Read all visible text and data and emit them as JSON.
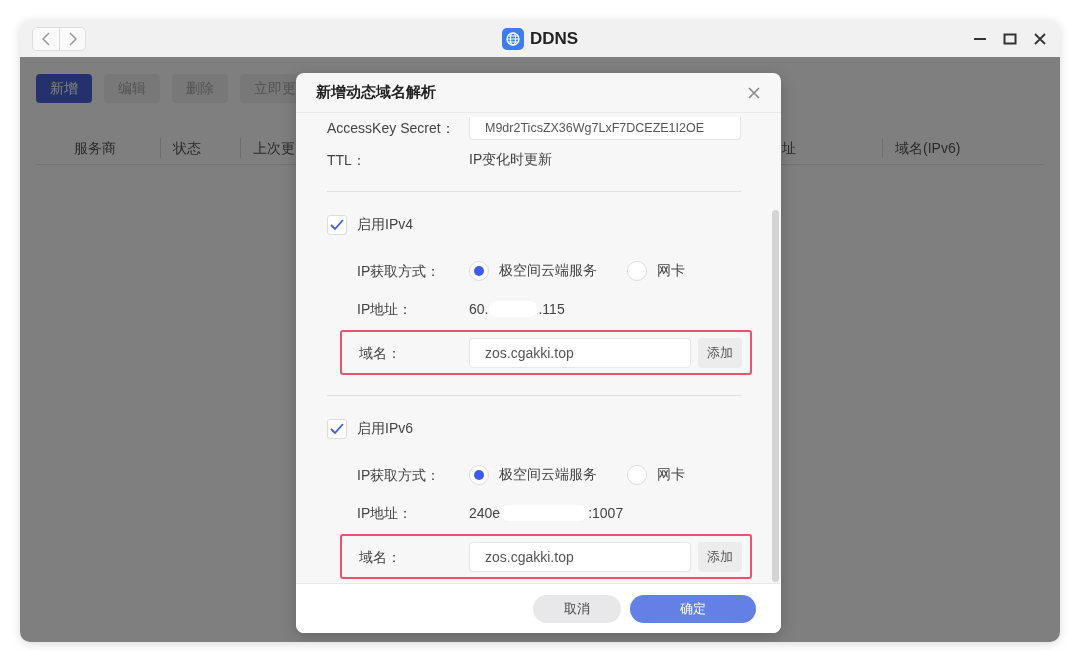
{
  "window": {
    "title": "DDNS"
  },
  "toolbar": [
    {
      "label": "新增",
      "kind": "primary"
    },
    {
      "label": "编辑",
      "kind": "plain"
    },
    {
      "label": "删除",
      "kind": "plain"
    },
    {
      "label": "立即更",
      "kind": "plain"
    }
  ],
  "table": {
    "columns": [
      "服务商",
      "状态",
      "上次更",
      "址",
      "域名(IPv6)"
    ]
  },
  "dialog": {
    "title": "新增动态域名解析",
    "fields": [
      {
        "label": "AccessKey Secret：",
        "value": "M9dr2TicsZX36Wg7LxF7DCEZE1I2OE",
        "kind": "input"
      },
      {
        "label": "TTL：",
        "value": "IP变化时更新",
        "kind": "text"
      }
    ],
    "sections": [
      {
        "label": "启用IPv4",
        "checked": true,
        "method_label": "IP获取方式：",
        "methods": [
          {
            "label": "极空间云端服务",
            "selected": true
          },
          {
            "label": "网卡",
            "selected": false
          }
        ],
        "address_label": "IP地址：",
        "address_parts": [
          "60.",
          ".115"
        ],
        "domain_label": "域名：",
        "domain": "zos.cgakki.top",
        "add_button": "添加",
        "highlighted": true
      },
      {
        "label": "启用IPv6",
        "checked": true,
        "method_label": "IP获取方式：",
        "methods": [
          {
            "label": "极空间云端服务",
            "selected": true
          },
          {
            "label": "网卡",
            "selected": false
          }
        ],
        "address_label": "IP地址：",
        "address_parts": [
          "240e",
          ":1007"
        ],
        "domain_label": "域名：",
        "domain": "zos.cgakki.top",
        "add_button": "添加",
        "highlighted": true
      }
    ],
    "buttons": [
      {
        "label": "取消",
        "kind": "secondary"
      },
      {
        "label": "确定",
        "kind": "primary"
      }
    ]
  }
}
